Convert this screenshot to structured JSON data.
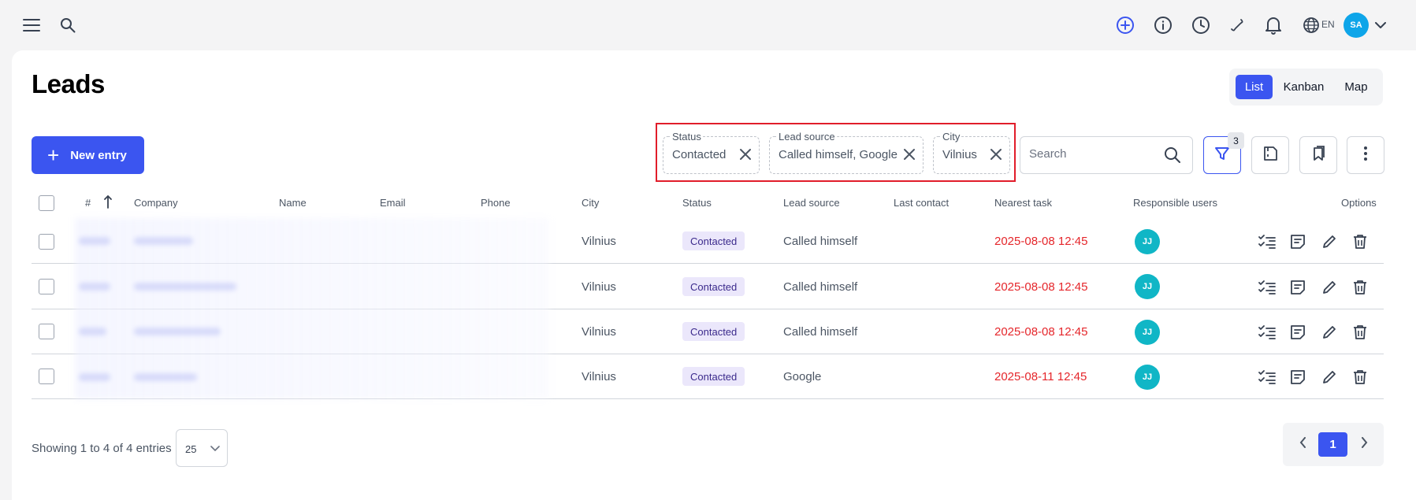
{
  "topbar": {
    "language": "EN",
    "user_initials": "SA",
    "icons": [
      "menu-icon",
      "search-icon",
      "add-circle-icon",
      "info-icon",
      "clock-icon",
      "phone-icon",
      "bell-icon",
      "globe-icon",
      "chevron-down-icon"
    ]
  },
  "page": {
    "title": "Leads"
  },
  "views": {
    "list": "List",
    "kanban": "Kanban",
    "map": "Map",
    "active": "List"
  },
  "toolbar": {
    "new_entry": "New entry",
    "search_placeholder": "Search",
    "filter_count": "3"
  },
  "filters": [
    {
      "label": "Status",
      "value": "Contacted"
    },
    {
      "label": "Lead source",
      "value": "Called himself, Google"
    },
    {
      "label": "City",
      "value": "Vilnius"
    }
  ],
  "table": {
    "headers": {
      "num": "#",
      "company": "Company",
      "name": "Name",
      "email": "Email",
      "phone": "Phone",
      "city": "City",
      "status": "Status",
      "lead_source": "Lead source",
      "last_contact": "Last contact",
      "nearest_task": "Nearest task",
      "responsible": "Responsible users",
      "options": "Options"
    },
    "rows": [
      {
        "city": "Vilnius",
        "status": "Contacted",
        "lead_source": "Called himself",
        "last_contact": "",
        "nearest_task": "2025-08-08 12:45",
        "user": "JJ"
      },
      {
        "city": "Vilnius",
        "status": "Contacted",
        "lead_source": "Called himself",
        "last_contact": "",
        "nearest_task": "2025-08-08 12:45",
        "user": "JJ"
      },
      {
        "city": "Vilnius",
        "status": "Contacted",
        "lead_source": "Called himself",
        "last_contact": "",
        "nearest_task": "2025-08-08 12:45",
        "user": "JJ"
      },
      {
        "city": "Vilnius",
        "status": "Contacted",
        "lead_source": "Google",
        "last_contact": "",
        "nearest_task": "2025-08-11 12:45",
        "user": "JJ"
      }
    ]
  },
  "footer": {
    "showing": "Showing 1 to 4 of 4 entries",
    "page_size": "25",
    "current_page": "1"
  },
  "colors": {
    "accent": "#3b55f0",
    "task_overdue": "#e5262b",
    "avatar": "#10b6c6",
    "status_badge_bg": "#ebe7fb"
  }
}
